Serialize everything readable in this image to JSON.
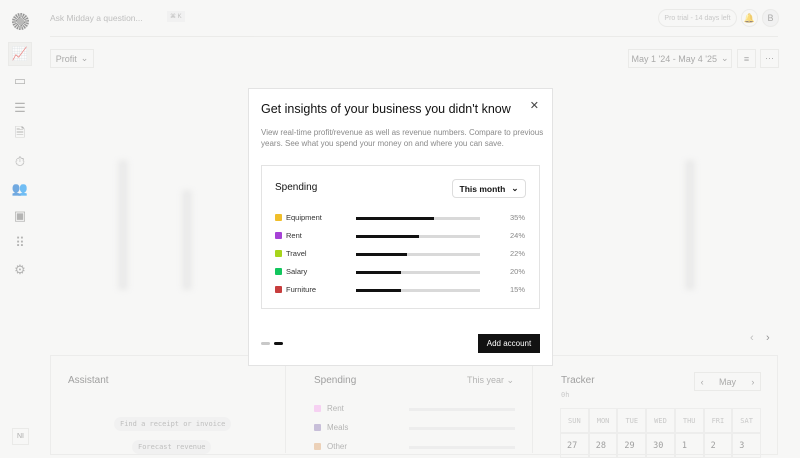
{
  "header": {
    "search_placeholder": "Ask Midday a question...",
    "shortcut": "⌘ K",
    "trial": "Pro trial - 14 days left",
    "avatar": "B"
  },
  "toolbar": {
    "metric": "Profit",
    "date_range": "May 1 '24 - May 4 '25"
  },
  "sidebar": {
    "user_initials": "NI"
  },
  "modal": {
    "title": "Get insights of your business you didn't know",
    "description": "View real-time profit/revenue as well as revenue numbers. Compare to previous years. See what you spend your money on and where you can save.",
    "card_title": "Spending",
    "period": "This month",
    "items": [
      {
        "label": "Equipment",
        "percent": "35%",
        "value": 0.63,
        "color": "#f0be2a"
      },
      {
        "label": "Rent",
        "percent": "24%",
        "value": 0.51,
        "color": "#a642d6"
      },
      {
        "label": "Travel",
        "percent": "22%",
        "value": 0.41,
        "color": "#a7d51c"
      },
      {
        "label": "Salary",
        "percent": "20%",
        "value": 0.36,
        "color": "#12c65e"
      },
      {
        "label": "Furniture",
        "percent": "15%",
        "value": 0.36,
        "color": "#c73d3d"
      }
    ],
    "add_button": "Add account",
    "step": 2,
    "steps": 2
  },
  "assistant": {
    "title": "Assistant",
    "suggestions": [
      "Find a receipt or invoice",
      "Forecast revenue"
    ]
  },
  "spending": {
    "title": "Spending",
    "period": "This year",
    "items": [
      {
        "label": "Rent",
        "color": "#f6b8f0"
      },
      {
        "label": "Meals",
        "color": "#a99bc7"
      },
      {
        "label": "Other",
        "color": "#e6b98f"
      }
    ]
  },
  "tracker": {
    "title": "Tracker",
    "total": "0h",
    "month": "May",
    "weekdays": [
      "SUN",
      "MON",
      "TUE",
      "WED",
      "THU",
      "FRI",
      "SAT"
    ],
    "days": [
      "27",
      "28",
      "29",
      "30",
      "1",
      "2",
      "3"
    ]
  }
}
